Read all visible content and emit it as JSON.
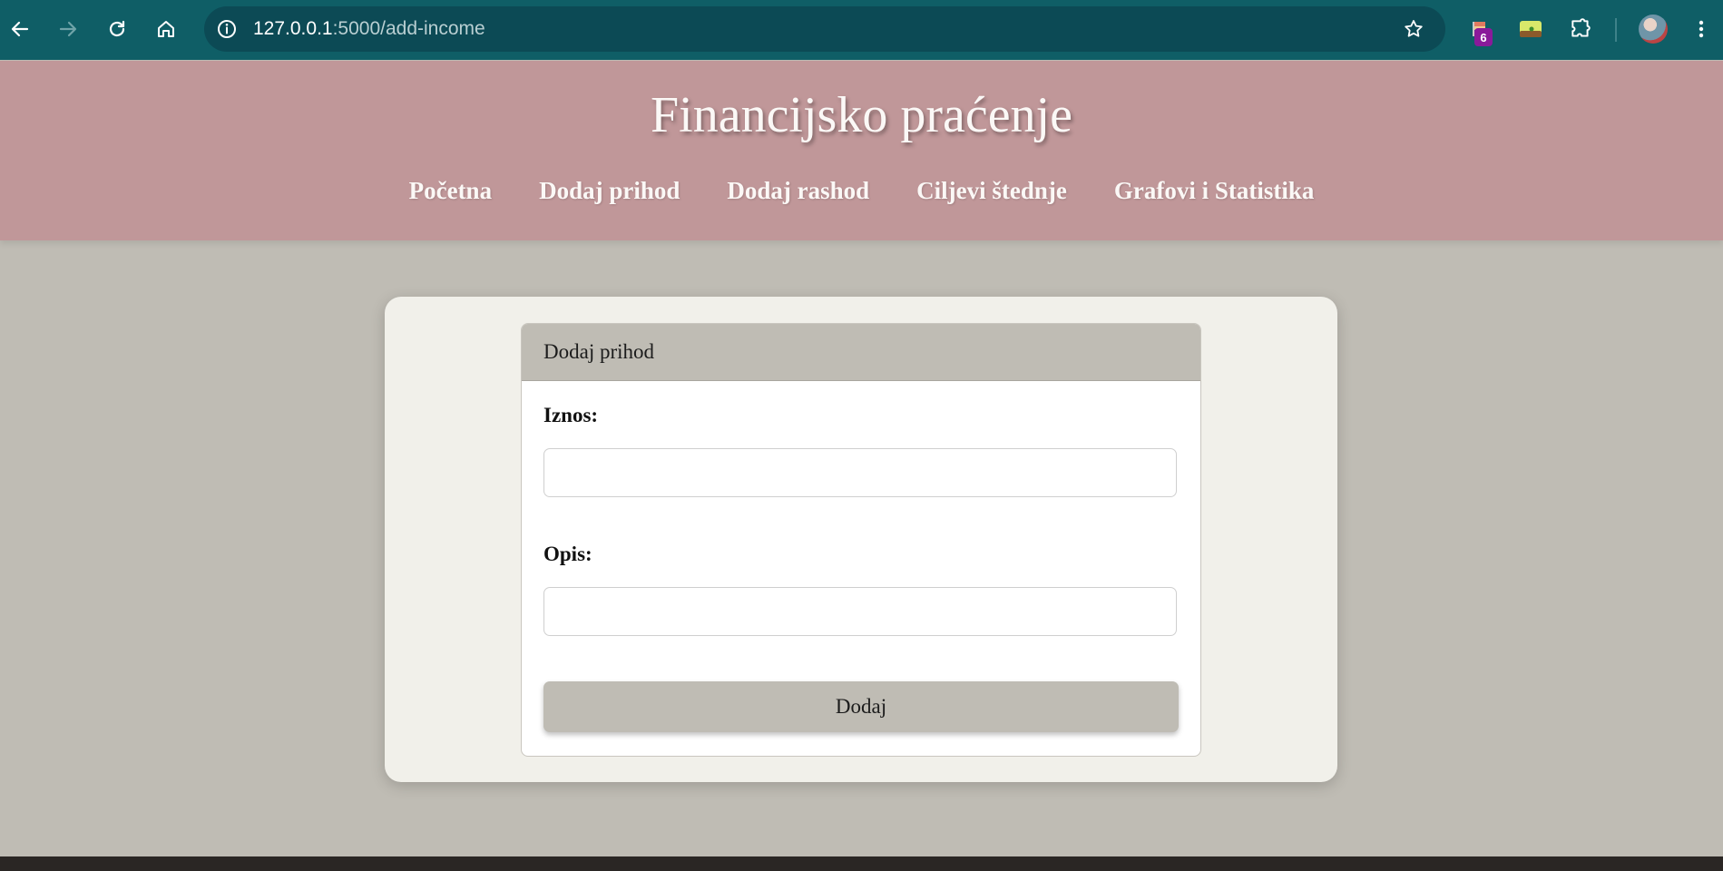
{
  "browser": {
    "url_host": "127.0.0.1",
    "url_path": ":5000/add-income",
    "extension_badge": "6"
  },
  "header": {
    "title": "Financijsko praćenje",
    "nav": [
      {
        "label": "Početna"
      },
      {
        "label": "Dodaj prihod"
      },
      {
        "label": "Dodaj rashod"
      },
      {
        "label": "Ciljevi štednje"
      },
      {
        "label": "Grafovi i Statistika"
      }
    ]
  },
  "form": {
    "title": "Dodaj prihod",
    "amount_label": "Iznos:",
    "amount_value": "",
    "description_label": "Opis:",
    "description_value": "",
    "submit_label": "Dodaj"
  },
  "colors": {
    "chrome": "#0f5e66",
    "header": "#c09799",
    "page_bg": "#bfbcb4",
    "card_bg": "#f1f0ea"
  }
}
